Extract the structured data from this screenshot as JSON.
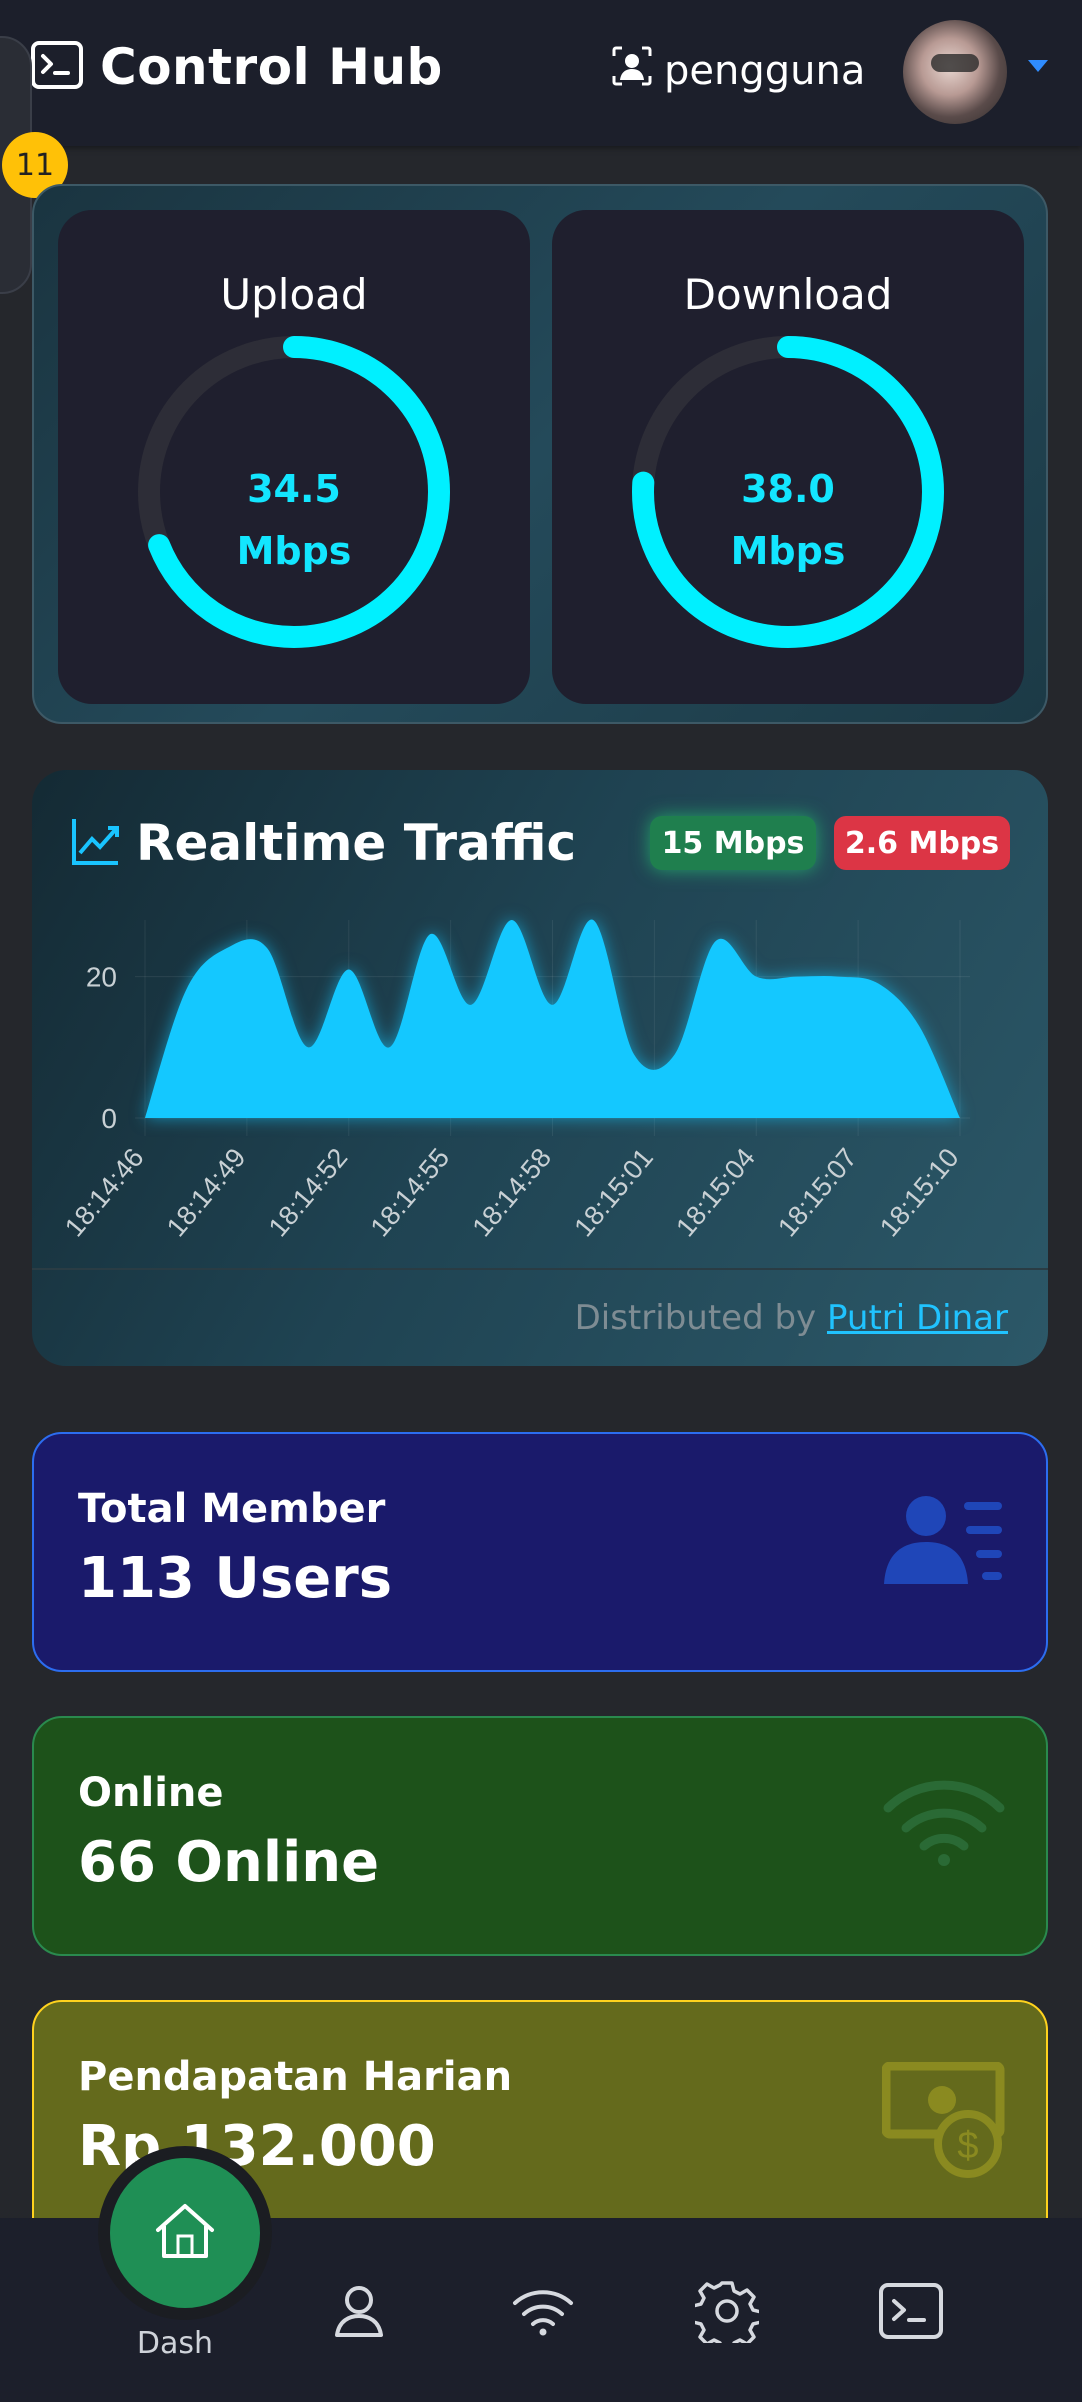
{
  "header": {
    "title": "Control Hub",
    "user_name": "pengguna",
    "notification_count": "11"
  },
  "gauges": [
    {
      "label": "Upload",
      "value": "34.5",
      "unit": "Mbps",
      "fraction": 0.69
    },
    {
      "label": "Download",
      "value": "38.0",
      "unit": "Mbps",
      "fraction": 0.76
    }
  ],
  "traffic": {
    "title": "Realtime Traffic",
    "upload_badge": "15 Mbps",
    "download_badge": "2.6 Mbps",
    "footer_prefix": "Distributed by",
    "footer_link": "Putri Dinar"
  },
  "chart_data": {
    "type": "area",
    "x_ticks": [
      "18:14:46",
      "18:14:49",
      "18:14:52",
      "18:14:55",
      "18:14:58",
      "18:15:01",
      "18:15:04",
      "18:15:07",
      "18:15:10"
    ],
    "y_ticks": [
      "0",
      "20"
    ],
    "ylim": [
      0,
      28
    ],
    "x": [
      0,
      1,
      2,
      3,
      4,
      5,
      6,
      7,
      8,
      9,
      10,
      11,
      12,
      13,
      14,
      15,
      16,
      17,
      18,
      19,
      20,
      21,
      22,
      23,
      24,
      25,
      26,
      27
    ],
    "values": [
      0,
      18,
      24,
      24,
      10,
      21,
      10,
      26,
      16,
      28,
      16,
      28,
      9,
      9,
      25,
      20,
      20,
      20,
      19,
      13,
      0,
      0,
      0,
      0,
      0,
      0,
      0,
      0
    ],
    "grid": true,
    "color": "#14c8ff"
  },
  "stats": {
    "member": {
      "label": "Total Member",
      "value": "113 Users"
    },
    "online": {
      "label": "Online",
      "value": "66 Online"
    },
    "income": {
      "label": "Pendapatan Harian",
      "value": "Rp 132.000"
    }
  },
  "nav": {
    "dash_label": "Dash"
  }
}
